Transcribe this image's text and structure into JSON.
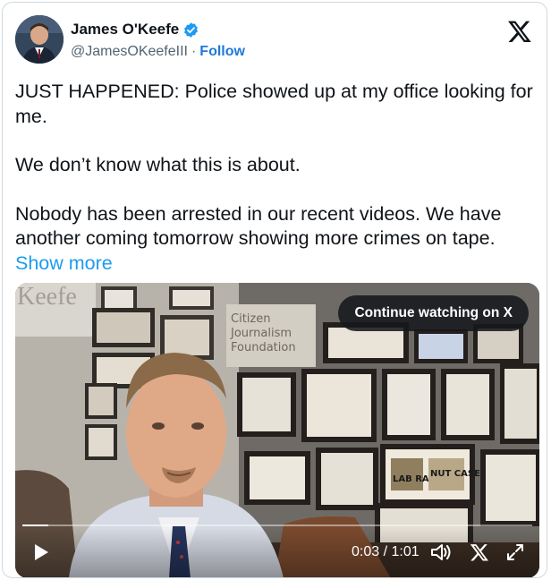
{
  "author": {
    "display_name": "James O'Keefe",
    "handle": "@JamesOKeefeIII",
    "separator": "·",
    "follow_label": "Follow",
    "verified": true
  },
  "tweet": {
    "paragraphs": [
      "JUST HAPPENED: Police showed up at my office looking for me.",
      "We don’t know what this is about.",
      "Nobody has been arrested in our recent videos. We have another coming tomorrow showing more crimes on tape."
    ],
    "show_more_label": "Show more"
  },
  "video": {
    "continue_label": "Continue watching on X",
    "time_current": "0:03",
    "time_separator": "/",
    "time_total": "1:01",
    "progress": 0.05,
    "wall_sign": [
      "Citizen",
      "Journalism",
      "Foundation"
    ],
    "headline_lab_rat": "LAB RAT",
    "headline_nut_case": "NUT CASE"
  },
  "icons": {
    "brand": "x-logo-icon",
    "verified": "verified-badge-icon",
    "play": "play-icon",
    "volume": "volume-icon",
    "fullscreen": "fullscreen-icon"
  },
  "colors": {
    "link": "#1d9bf0",
    "follow": "#1d7ad6",
    "verified": "#1d9bf0"
  }
}
